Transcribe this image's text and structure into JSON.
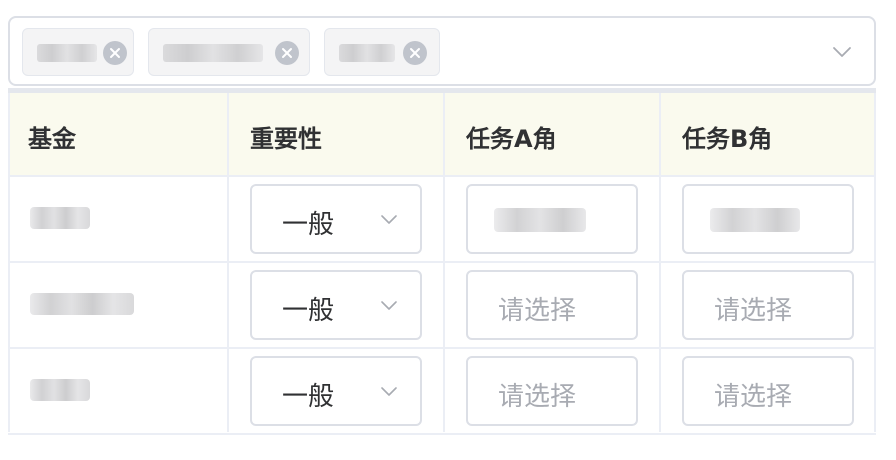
{
  "filter": {
    "tags": [
      {
        "label": ""
      },
      {
        "label": ""
      },
      {
        "label": ""
      }
    ]
  },
  "table": {
    "headers": [
      "基金",
      "重要性",
      "任务A角",
      "任务B角"
    ],
    "rows": [
      {
        "fund": "",
        "importance": "一般",
        "taskA": "",
        "taskB": ""
      },
      {
        "fund": "",
        "importance": "一般",
        "taskA": "",
        "taskB": ""
      },
      {
        "fund": "",
        "importance": "一般",
        "taskA": "",
        "taskB": ""
      }
    ],
    "placeholder": "请选择"
  },
  "colors": {
    "header_bg": "#fafaee",
    "border": "#dcdfe6",
    "placeholder": "#a8abb2",
    "tag_close": "#c0c4cc"
  },
  "icons": {
    "tag_close": "close-icon",
    "caret": "chevron-down-icon"
  }
}
